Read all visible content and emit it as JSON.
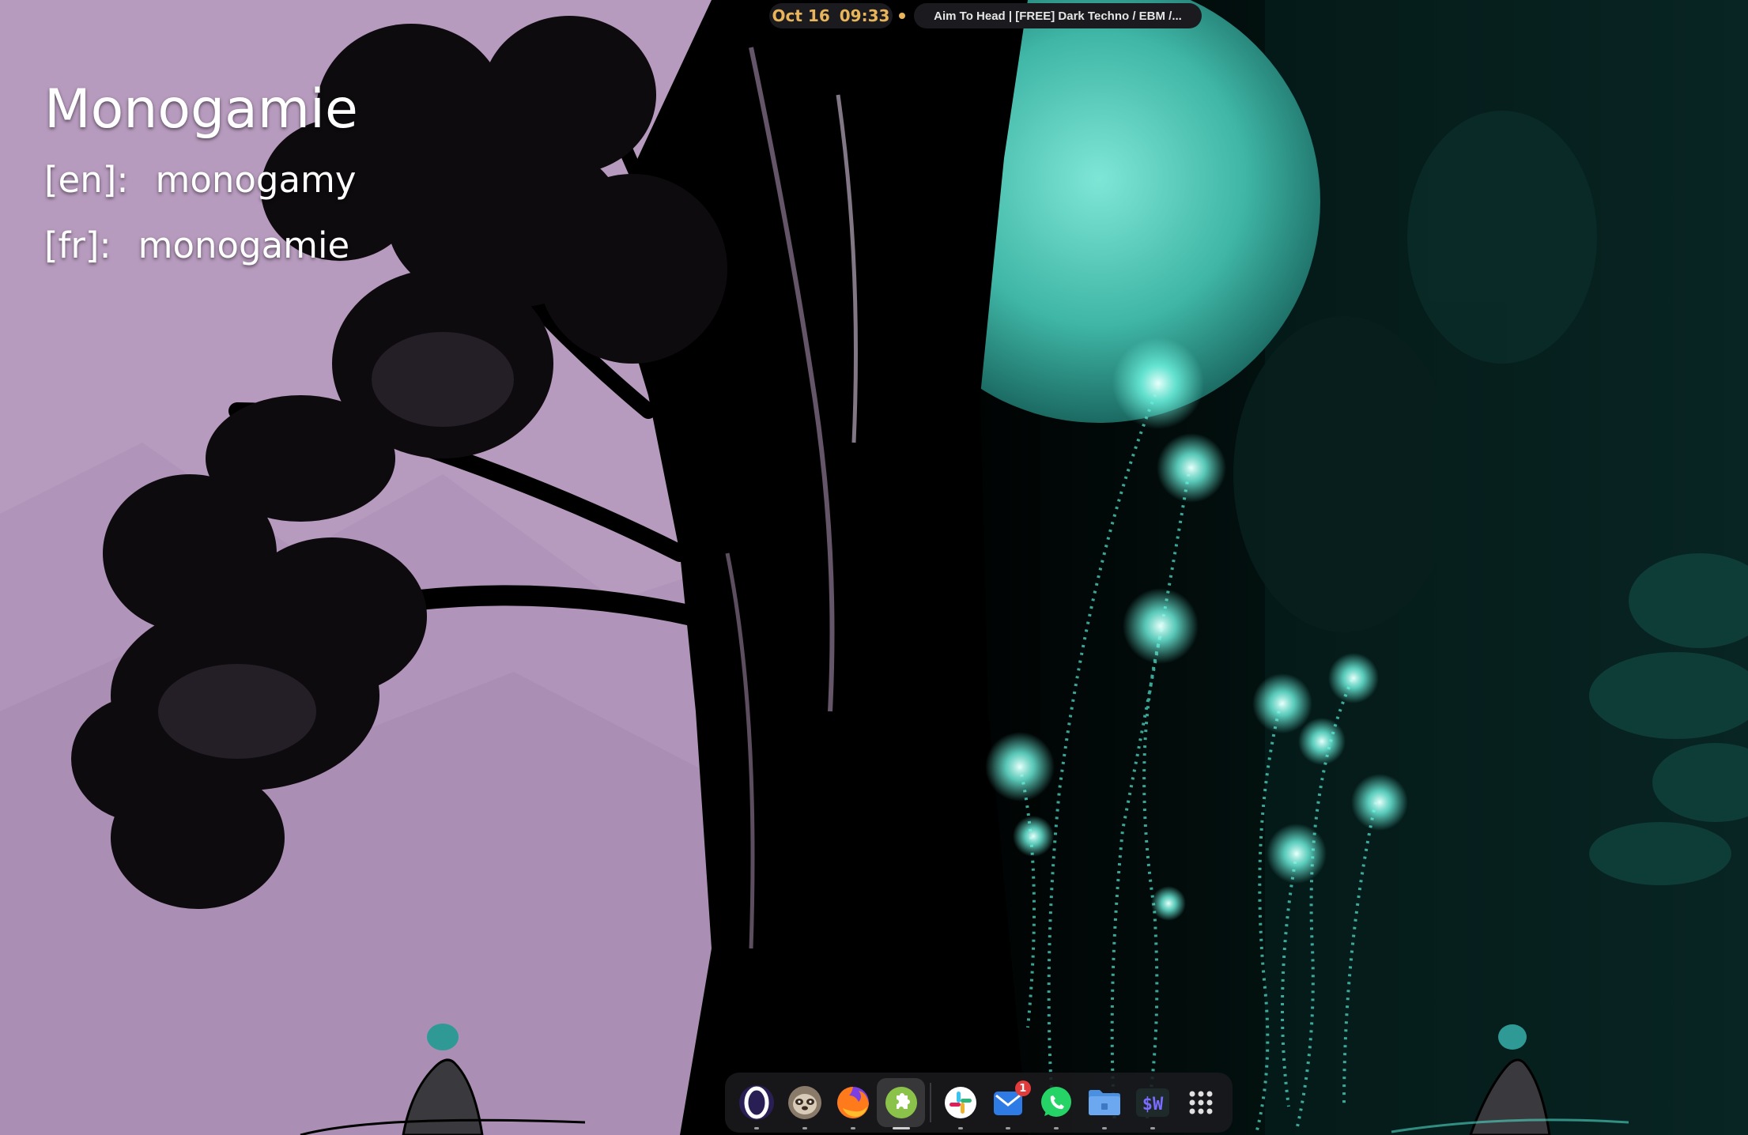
{
  "topbar": {
    "date": "Oct 16",
    "time": "09:33",
    "media_title": "Aim To Head | [FREE] Dark Techno / EBM /...",
    "accent": "#e9b55a"
  },
  "word_widget": {
    "word": "Monogamie",
    "translations": [
      {
        "lang": "[en]:",
        "text": "monogamy"
      },
      {
        "lang": "[fr]:",
        "text": "monogamie"
      }
    ]
  },
  "dock": {
    "apps": [
      {
        "name": "opera-icon",
        "active": false
      },
      {
        "name": "sloth-avatar-icon",
        "active": false
      },
      {
        "name": "firefox-icon",
        "active": false
      },
      {
        "name": "extensions-puzzle-icon",
        "active": true
      },
      {
        "name": "slack-icon",
        "active": false
      },
      {
        "name": "mail-icon",
        "active": false,
        "badge": "1"
      },
      {
        "name": "whatsapp-icon",
        "active": false
      },
      {
        "name": "files-folder-icon",
        "active": false
      },
      {
        "name": "terminal-icon",
        "active": false,
        "label": "$W"
      },
      {
        "name": "app-grid-icon",
        "active": false
      }
    ]
  },
  "colors": {
    "lavender": "#b79bbe",
    "teal_glow": "#5ff5e0",
    "dark": "#000000"
  }
}
